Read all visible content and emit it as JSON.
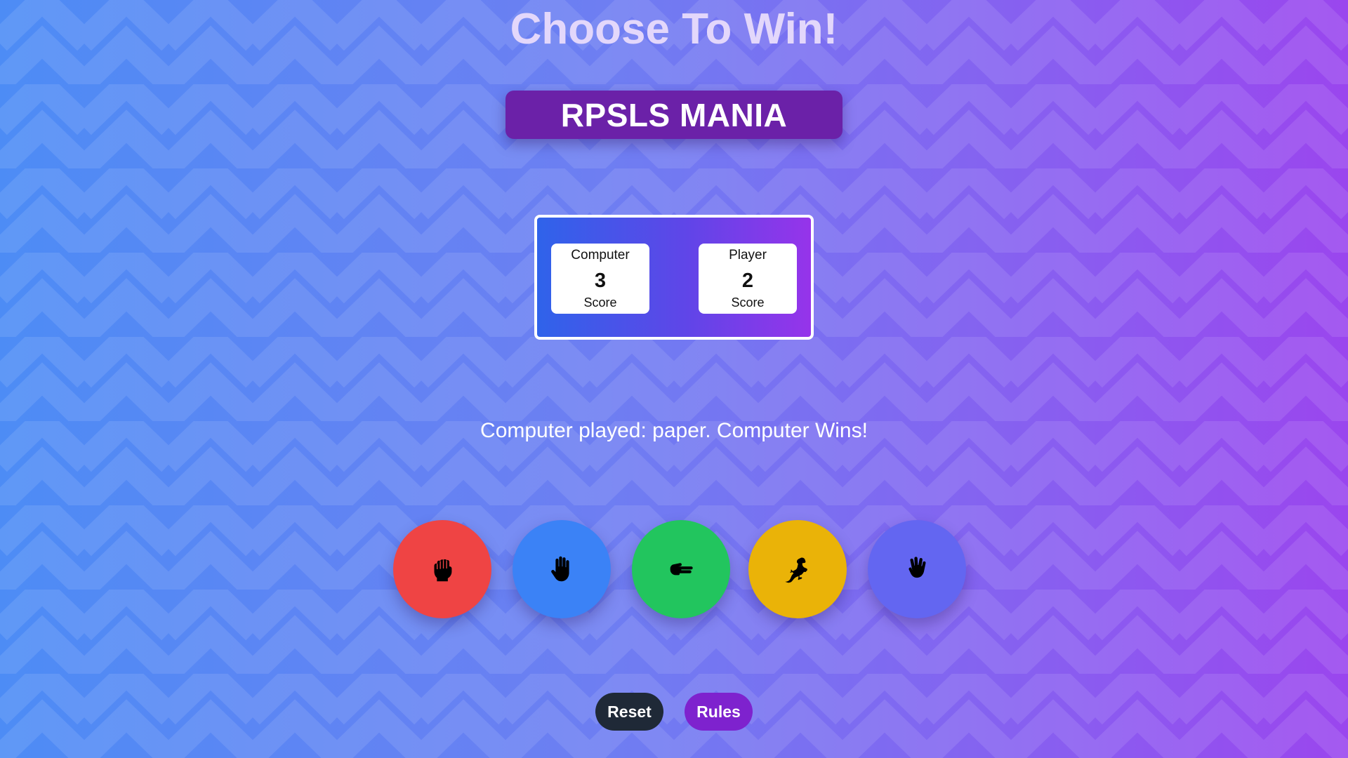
{
  "page": {
    "title": "Choose To Win!",
    "brand": "RPSLS MANIA"
  },
  "scoreboard": {
    "computer": {
      "label": "Computer",
      "score": "3",
      "caption": "Score"
    },
    "player": {
      "label": "Player",
      "score": "2",
      "caption": "Score"
    }
  },
  "result": {
    "message": "Computer played: paper. Computer Wins!"
  },
  "choices": [
    {
      "name": "rock",
      "icon": "fist-icon",
      "color": "#ef4444"
    },
    {
      "name": "paper",
      "icon": "open-hand-icon",
      "color": "#3b82f6"
    },
    {
      "name": "scissors",
      "icon": "scissors-hand-icon",
      "color": "#22c55e"
    },
    {
      "name": "lizard",
      "icon": "lizard-icon",
      "color": "#eab308"
    },
    {
      "name": "spock",
      "icon": "vulcan-salute-icon",
      "color": "#6366f1"
    }
  ],
  "controls": {
    "reset_label": "Reset",
    "rules_label": "Rules"
  },
  "colors": {
    "background_start": "#4d8cf5",
    "background_end": "#9a46ee",
    "banner": "#6b21a8",
    "reset_button": "#1f2937",
    "rules_button": "#7e22ce"
  }
}
